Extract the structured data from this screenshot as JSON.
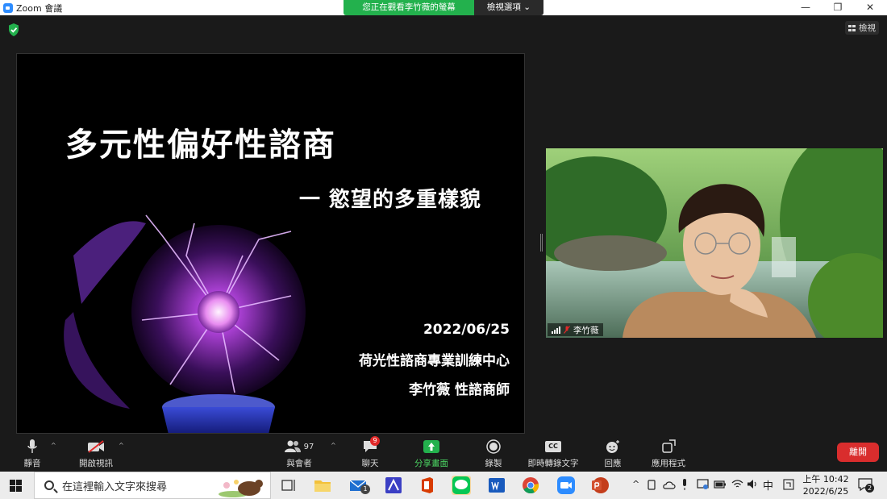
{
  "window": {
    "app_title": "Zoom 會議",
    "controls": {
      "minimize": "—",
      "restore": "❐",
      "close": "✕"
    }
  },
  "banner": {
    "viewing_text": "您正在觀看李竹薇的螢幕",
    "view_options_label": "檢視選項",
    "view_options_chevron": "⌄"
  },
  "meeting": {
    "security_icon": "shield-check-icon",
    "view_button_label": "檢視"
  },
  "slide": {
    "title": "多元性偏好性諮商",
    "subtitle": "一 慾望的多重樣貌",
    "date": "2022/06/25",
    "organization": "荷光性諮商專業訓練中心",
    "presenter": "李竹薇 性諮商師"
  },
  "video": {
    "participant_name": "李竹薇"
  },
  "toolbar": {
    "mute_label": "靜音",
    "video_label": "開啟視訊",
    "participants_label": "與會者",
    "participants_count": "97",
    "chat_label": "聊天",
    "chat_badge": "9",
    "share_label": "分享畫面",
    "record_label": "錄製",
    "cc_icon_text": "CC",
    "captions_label": "即時轉錄文字",
    "reactions_label": "回應",
    "apps_label": "應用程式",
    "leave_label": "離開",
    "caret": "^"
  },
  "taskbar": {
    "search_placeholder": "在這裡輸入文字來搜尋",
    "tray_ime": "中",
    "tray_expand": "^",
    "clock_time": "上午 10:42",
    "clock_date": "2022/6/25",
    "notification_count": "2",
    "mail_badge": "1",
    "apps": [
      "task-view-icon",
      "file-explorer-icon",
      "mail-icon",
      "kanban-icon",
      "office-icon",
      "line-icon",
      "word-icon",
      "chrome-icon",
      "zoom-icon",
      "powerpoint-icon"
    ]
  },
  "colors": {
    "share_green": "#4cd964",
    "banner_green": "#23b14d",
    "leave_red": "#d92d2d",
    "badge_red": "#e02828",
    "zoom_blue": "#2d8cff"
  }
}
